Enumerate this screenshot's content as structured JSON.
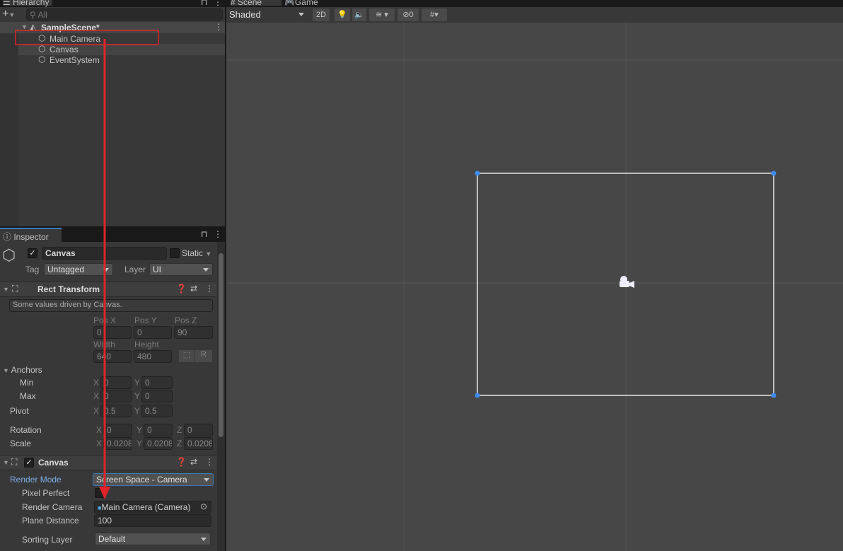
{
  "hierarchy": {
    "tab": "Hierarchy",
    "search_placeholder": "All",
    "scene": "SampleScene*",
    "items": [
      "Main Camera",
      "Canvas",
      "EventSystem"
    ]
  },
  "scene_view": {
    "tabs": [
      "Scene",
      "Game"
    ],
    "shading": "Shaded",
    "mode_2d": "2D",
    "hidden_count": "0"
  },
  "inspector": {
    "tab": "Inspector",
    "object_name": "Canvas",
    "static_label": "Static",
    "tag_label": "Tag",
    "tag_value": "Untagged",
    "layer_label": "Layer",
    "layer_value": "UI",
    "rect_transform": {
      "title": "Rect Transform",
      "note": "Some values driven by Canvas.",
      "pos_x_label": "Pos X",
      "pos_y_label": "Pos Y",
      "pos_z_label": "Pos Z",
      "pos_x": "0",
      "pos_y": "0",
      "pos_z": "90",
      "width_label": "Width",
      "height_label": "Height",
      "width": "640",
      "height": "480",
      "r_button": "R",
      "anchors_label": "Anchors",
      "min_label": "Min",
      "max_label": "Max",
      "pivot_label": "Pivot",
      "x": "X",
      "y": "Y",
      "z": "Z",
      "min_x": "0",
      "min_y": "0",
      "max_x": "0",
      "max_y": "0",
      "pivot_x": "0.5",
      "pivot_y": "0.5",
      "rotation_label": "Rotation",
      "rot_x": "0",
      "rot_y": "0",
      "rot_z": "0",
      "scale_label": "Scale",
      "scale_x": "0.0208",
      "scale_y": "0.0208",
      "scale_z": "0.0208"
    },
    "canvas": {
      "title": "Canvas",
      "render_mode_label": "Render Mode",
      "render_mode": "Screen Space - Camera",
      "pixel_perfect_label": "Pixel Perfect",
      "render_camera_label": "Render Camera",
      "render_camera": "Main Camera (Camera)",
      "plane_distance_label": "Plane Distance",
      "plane_distance": "100",
      "sorting_layer_label": "Sorting Layer",
      "sorting_layer": "Default"
    }
  },
  "colors": {
    "annotation": "#e0242a",
    "accent": "#3a79bb",
    "handle": "#3d8bf0"
  }
}
